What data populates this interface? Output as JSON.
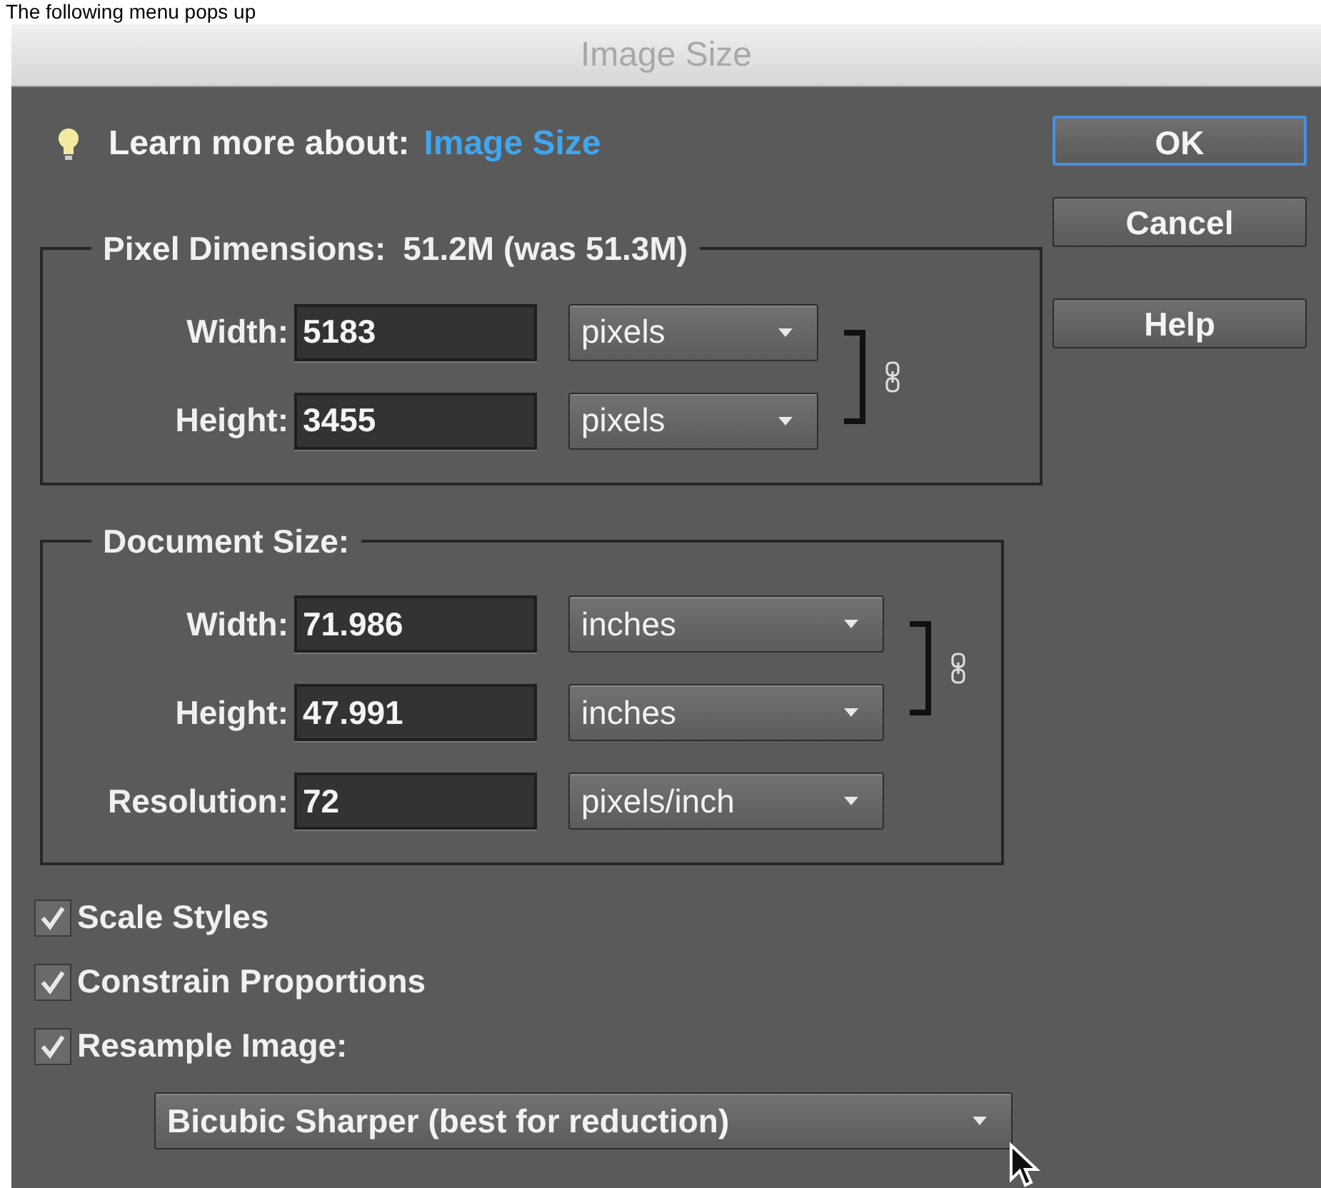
{
  "prompt_text": "The following menu pops up",
  "window": {
    "title": "Image Size"
  },
  "learn_more": {
    "label": "Learn more about:",
    "link": "Image Size"
  },
  "buttons": [
    {
      "label": "OK",
      "default": true
    },
    {
      "label": "Cancel",
      "default": false
    },
    {
      "label": "Help",
      "default": false
    }
  ],
  "pixel_dimensions": {
    "title": "Pixel Dimensions:",
    "size": "51.2M (was 51.3M)",
    "fields": [
      {
        "label": "Width:",
        "value": "5183",
        "unit": "pixels",
        "linked": true
      },
      {
        "label": "Height:",
        "value": "3455",
        "unit": "pixels",
        "linked": true
      }
    ]
  },
  "document_size": {
    "title": "Document Size:",
    "fields": [
      {
        "label": "Width:",
        "value": "71.986",
        "unit": "inches",
        "linked": true
      },
      {
        "label": "Height:",
        "value": "47.991",
        "unit": "inches",
        "linked": true
      },
      {
        "label": "Resolution:",
        "value": "72",
        "unit": "pixels/inch",
        "linked": false
      }
    ]
  },
  "options": [
    {
      "label": "Scale Styles",
      "checked": true
    },
    {
      "label": "Constrain Proportions",
      "checked": true
    },
    {
      "label": "Resample Image:",
      "checked": true
    }
  ],
  "resample_method": "Bicubic Sharper (best for reduction)"
}
